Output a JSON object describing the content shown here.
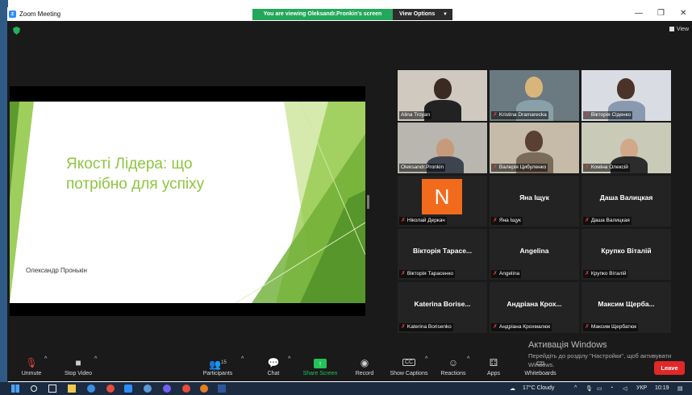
{
  "window": {
    "title": "Zoom Meeting",
    "viewing_banner": "You are viewing Oleksandr.Pronkin's screen",
    "view_options": "View Options",
    "view_label": "View",
    "controls": [
      "—",
      "❐",
      "✕"
    ]
  },
  "slide": {
    "title": "Якості Лідера: що потрібно для успіху",
    "presenter": "Олександр Пронькін"
  },
  "participants": [
    {
      "name": "Alina Troyan",
      "muted": false,
      "video": true,
      "active": false
    },
    {
      "name": "Kristina Dramarecka",
      "muted": true,
      "video": true,
      "active": false
    },
    {
      "name": "Вікторія Сіденко",
      "muted": true,
      "video": true,
      "active": false
    },
    {
      "name": "Oleksandr.Pronkin",
      "muted": false,
      "video": true,
      "active": true
    },
    {
      "name": "Валерія Цибуленко",
      "muted": true,
      "video": true,
      "active": false
    },
    {
      "name": "Комінa Олексій",
      "muted": true,
      "video": true,
      "active": false
    },
    {
      "name": "Ніколай Деркач",
      "muted": true,
      "video": false,
      "avatar": "N",
      "active": false
    },
    {
      "name": "Яна Іщук",
      "display": "Яна Іщук",
      "muted": true,
      "video": false,
      "active": false
    },
    {
      "name": "Даша Валицкая",
      "display": "Даша Валицкая",
      "muted": true,
      "video": false,
      "active": false
    },
    {
      "name": "Вікторія Тарасенко",
      "display": "Вікторія Тарасе...",
      "muted": true,
      "video": false,
      "active": false
    },
    {
      "name": "Angelina",
      "display": "Angelina",
      "muted": true,
      "video": false,
      "active": false
    },
    {
      "name": "Крупко Віталій",
      "display": "Крупко Віталій",
      "muted": true,
      "video": false,
      "active": false
    },
    {
      "name": "Katerina Borisenko",
      "display": "Katerina Borise...",
      "muted": true,
      "video": false,
      "active": false
    },
    {
      "name": "Андріана Крохмалюк",
      "display": "Андріана Крох...",
      "muted": true,
      "video": false,
      "active": false
    },
    {
      "name": "Максим Щербатюк",
      "display": "Максим Щерба...",
      "muted": true,
      "video": false,
      "active": false
    }
  ],
  "toolbar": {
    "unmute": "Unmute",
    "stop_video": "Stop Video",
    "participants": "Participants",
    "participants_count": "15",
    "chat": "Chat",
    "share_screen": "Share Screen",
    "record": "Record",
    "show_captions": "Show Captions",
    "cc": "CC",
    "reactions": "Reactions",
    "apps": "Apps",
    "whiteboards": "Whiteboards",
    "leave": "Leave"
  },
  "watermark": {
    "line1": "Активація Windows",
    "line2": "Перейдіть до розділу \"Настройки\", щоб активувати Windows."
  },
  "taskbar": {
    "weather": "17°C  Cloudy",
    "lang": "УКР",
    "time": "10:19"
  },
  "colors": {
    "accent_green": "#23a75a",
    "slide_green": "#8dc640",
    "leave_red": "#e02828"
  }
}
